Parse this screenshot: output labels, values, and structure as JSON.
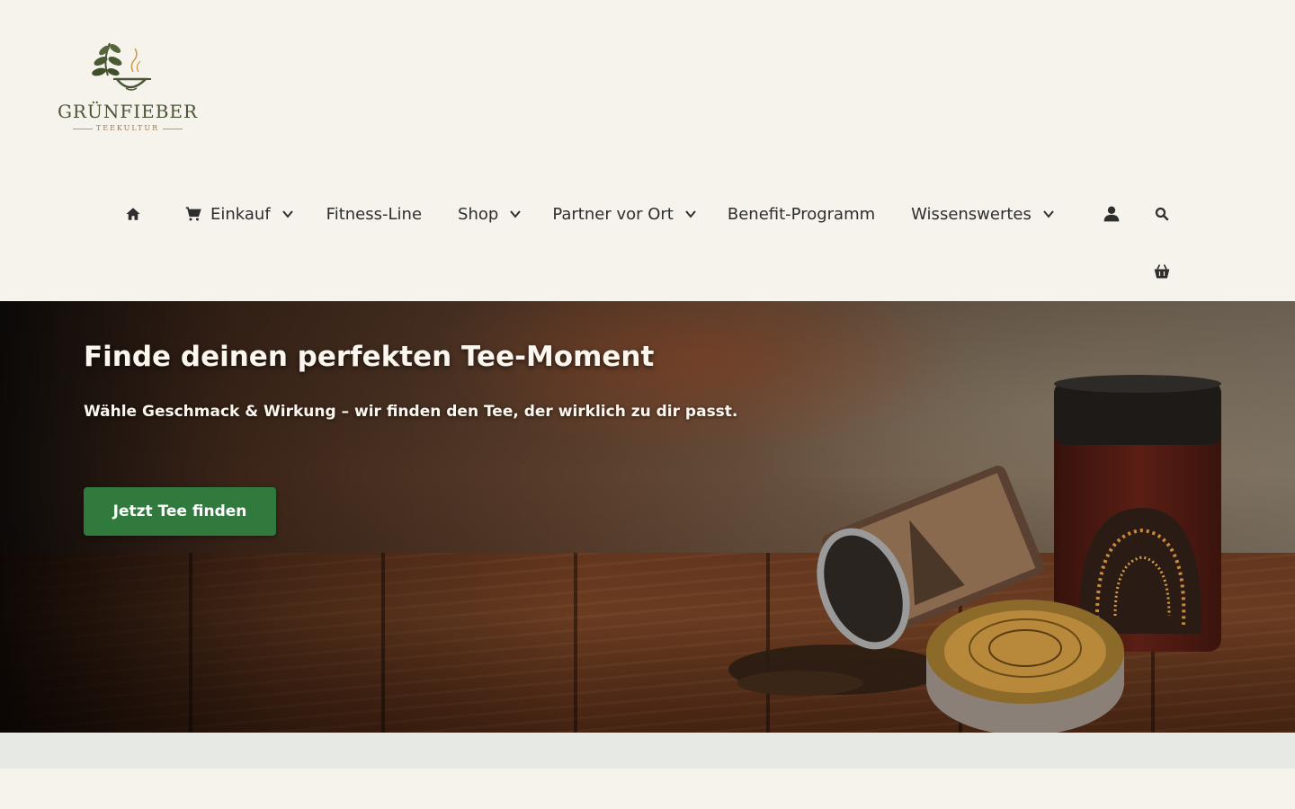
{
  "brand": {
    "name": "GRÜNFIEBER",
    "tagline": "TEEKULTUR",
    "logo_icon": "tea-cup-leaf-icon",
    "color_green": "#4a5536",
    "color_gold": "#9a7a45"
  },
  "nav": {
    "home_icon": "home-icon",
    "items": [
      {
        "label": "Einkauf",
        "icon": "cart-icon",
        "has_dropdown": true
      },
      {
        "label": "Fitness-Line",
        "has_dropdown": false
      },
      {
        "label": "Shop",
        "has_dropdown": true
      },
      {
        "label": "Partner vor Ort",
        "has_dropdown": true
      },
      {
        "label": "Benefit-Programm",
        "has_dropdown": false
      },
      {
        "label": "Wissenswertes",
        "has_dropdown": true
      }
    ],
    "account_icon": "user-icon",
    "search_icon": "search-icon",
    "basket_icon": "basket-icon"
  },
  "hero": {
    "title": "Finde deinen perfekten Tee-Moment",
    "subtitle": "Wähle Geschmack & Wirkung – wir finden den Tee, der wirklich zu dir passt.",
    "cta_label": "Jetzt Tee finden",
    "cta_color": "#2f7a3c"
  }
}
